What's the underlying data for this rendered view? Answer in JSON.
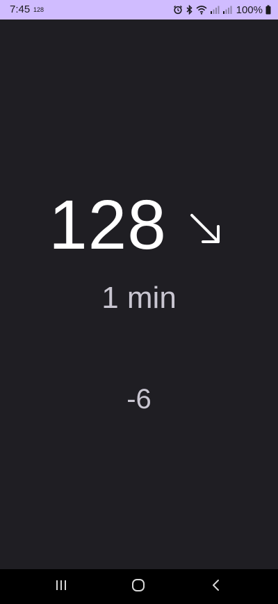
{
  "status_bar": {
    "time": "7:45",
    "notification_value": "128",
    "battery": "100%",
    "icons": [
      "alarm-icon",
      "bluetooth-icon",
      "wifi-icon",
      "signal-icon",
      "signal-icon",
      "battery-icon"
    ],
    "background_color": "#d0bcff"
  },
  "reading": {
    "glucose_value": "128",
    "trend_icon": "arrow-down-right-icon",
    "elapsed_time": "1 min",
    "delta": "-6"
  },
  "nav_bar": {
    "buttons": [
      "recents-icon",
      "home-icon",
      "back-icon"
    ]
  },
  "colors": {
    "background": "#1f1e23",
    "primary_text": "#ffffff",
    "secondary_text": "#c9c6d1"
  }
}
